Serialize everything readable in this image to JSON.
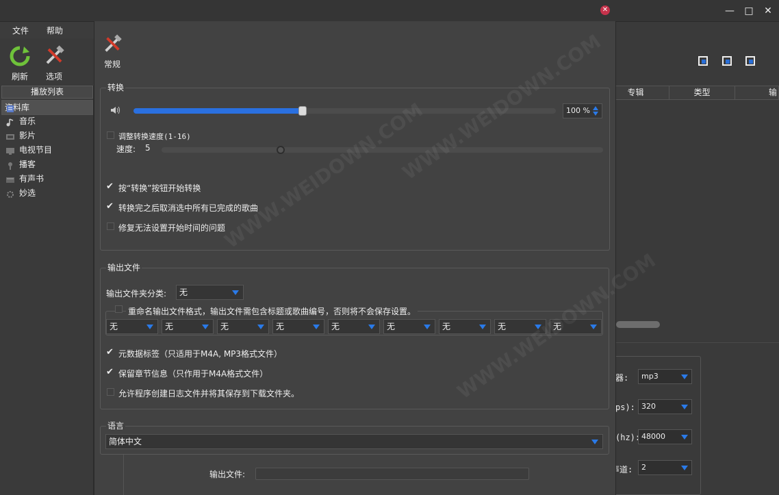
{
  "window": {
    "controls": [
      "minimize-icon",
      "maximize-icon",
      "close-icon"
    ]
  },
  "menu": {
    "file": "文件",
    "help": "帮助"
  },
  "toolbar": {
    "refresh": "刷新",
    "options": "选项"
  },
  "sidebar": {
    "header": "播放列表",
    "items": [
      {
        "label": "资料库",
        "icon": "library-icon"
      },
      {
        "label": "音乐",
        "icon": "music-icon"
      },
      {
        "label": "影片",
        "icon": "film-icon"
      },
      {
        "label": "电视节目",
        "icon": "tv-icon"
      },
      {
        "label": "播客",
        "icon": "podcast-icon"
      },
      {
        "label": "有声书",
        "icon": "audiobook-icon"
      },
      {
        "label": "妙选",
        "icon": "genius-icon"
      }
    ]
  },
  "table": {
    "columns": [
      "专辑",
      "类型",
      "输"
    ]
  },
  "right_panel": {
    "rows": [
      {
        "label": "器:",
        "value": "mp3"
      },
      {
        "label": "ps):",
        "value": "320"
      },
      {
        "label": "(hz):",
        "value": "48000"
      },
      {
        "label": "声道:",
        "value": "2"
      }
    ]
  },
  "output_file_label": "输出文件:",
  "dialog": {
    "tab_label": "常规",
    "convert": {
      "title": "转换",
      "volume_percent": "100 %",
      "volume_fraction": 0.4,
      "adjust_speed_label": "调整转换速度(1-16)",
      "speed_label": "速度:",
      "speed_value": "5",
      "speed_fraction": 0.27,
      "options": [
        {
          "label": "按“转换”按钮开始转换",
          "checked": true
        },
        {
          "label": "转换完之后取消选中所有已完成的歌曲",
          "checked": true
        },
        {
          "label": "修复无法设置开始时间的问题",
          "checked": false
        }
      ]
    },
    "output": {
      "title": "输出文件",
      "folder_category_label": "输出文件夹分类:",
      "folder_category_value": "无",
      "rename_label": "重命名输出文件格式，输出文件需包含标题或歌曲编号，否则将不会保存设置。",
      "rename_slots": [
        "无",
        "无",
        "无",
        "无",
        "无",
        "无",
        "无",
        "无",
        "无"
      ],
      "options": [
        {
          "label": "元数据标签（只适用于M4A, MP3格式文件）",
          "checked": true
        },
        {
          "label": "保留章节信息（只作用于M4A格式文件）",
          "checked": true
        },
        {
          "label": "允许程序创建日志文件并将其保存到下载文件夹。",
          "checked": false
        }
      ]
    },
    "language": {
      "title": "语言",
      "value": "简体中文"
    }
  },
  "colors": {
    "accent": "#2a70e0",
    "close": "#c6324b",
    "background": "#424242"
  }
}
